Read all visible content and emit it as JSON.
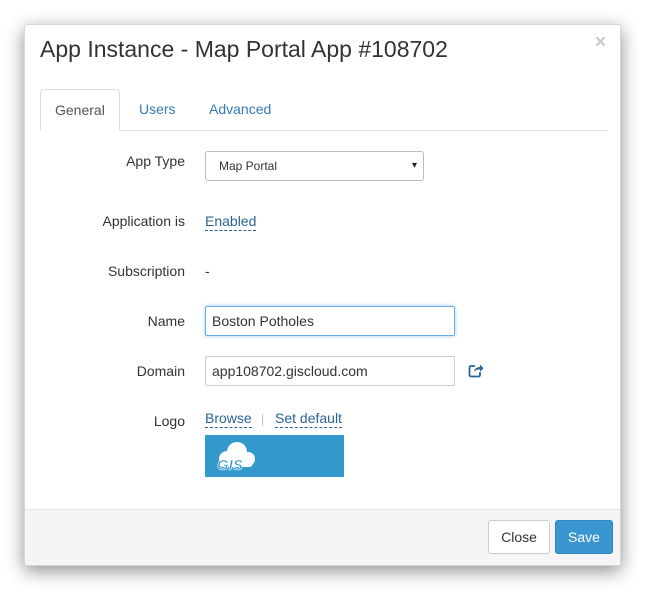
{
  "modal": {
    "title": "App Instance - Map Portal App #108702",
    "close_symbol": "×"
  },
  "tabs": [
    {
      "label": "General",
      "active": true
    },
    {
      "label": "Users",
      "active": false
    },
    {
      "label": "Advanced",
      "active": false
    }
  ],
  "form": {
    "app_type": {
      "label": "App Type",
      "value": "Map Portal",
      "caret": "▾"
    },
    "status": {
      "label": "Application is",
      "value": "Enabled"
    },
    "subscription": {
      "label": "Subscription",
      "value": "-"
    },
    "name": {
      "label": "Name",
      "value": "Boston Potholes"
    },
    "domain": {
      "label": "Domain",
      "value": "app108702.giscloud.com",
      "icon": "external-link-icon"
    },
    "logo": {
      "label": "Logo",
      "browse": "Browse",
      "separator": "|",
      "set_default": "Set default",
      "image_text": "GIS",
      "icon": "cloud-icon"
    }
  },
  "footer": {
    "close_label": "Close",
    "save_label": "Save"
  },
  "colors": {
    "primary": "#3a96d0",
    "link": "#2a6496",
    "logo_bg": "#3399cc"
  }
}
